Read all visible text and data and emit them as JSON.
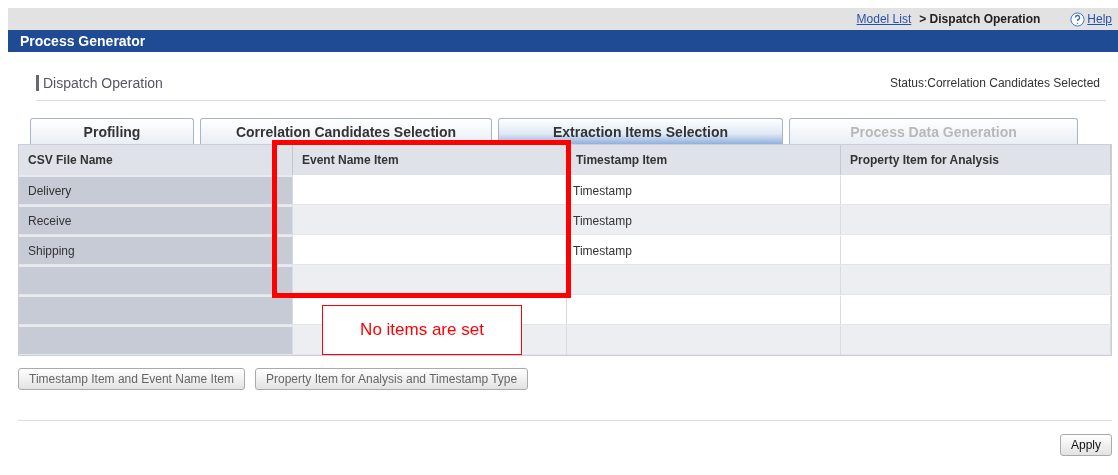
{
  "breadcrumb": {
    "link": "Model List",
    "current": "> Dispatch Operation",
    "help": "Help"
  },
  "window": {
    "title": "Process Generator"
  },
  "page": {
    "title": "Dispatch Operation",
    "status": "Status:Correlation Candidates Selected"
  },
  "tabs": [
    {
      "label": "Profiling",
      "selected": false,
      "disabled": false
    },
    {
      "label": "Correlation Candidates Selection",
      "selected": false,
      "disabled": false
    },
    {
      "label": "Extraction Items Selection",
      "selected": true,
      "disabled": false
    },
    {
      "label": "Process Data Generation",
      "selected": false,
      "disabled": true
    }
  ],
  "table": {
    "columns": [
      "CSV File Name",
      "Event Name Item",
      "Timestamp Item",
      "Property Item for Analysis"
    ],
    "rows": [
      [
        "Delivery",
        "",
        "Timestamp",
        ""
      ],
      [
        "Receive",
        "",
        "Timestamp",
        ""
      ],
      [
        "Shipping",
        "",
        "Timestamp",
        ""
      ],
      [
        "",
        "",
        "",
        ""
      ],
      [
        "",
        "",
        "",
        ""
      ],
      [
        "",
        "",
        "",
        ""
      ]
    ]
  },
  "item_buttons": [
    {
      "label": "Timestamp Item and Event Name Item",
      "disabled": true
    },
    {
      "label": "Property Item for Analysis and Timestamp Type",
      "disabled": true
    }
  ],
  "apply_button": {
    "label": "Apply",
    "disabled": false
  },
  "annotation": {
    "callout": "No items are set"
  }
}
